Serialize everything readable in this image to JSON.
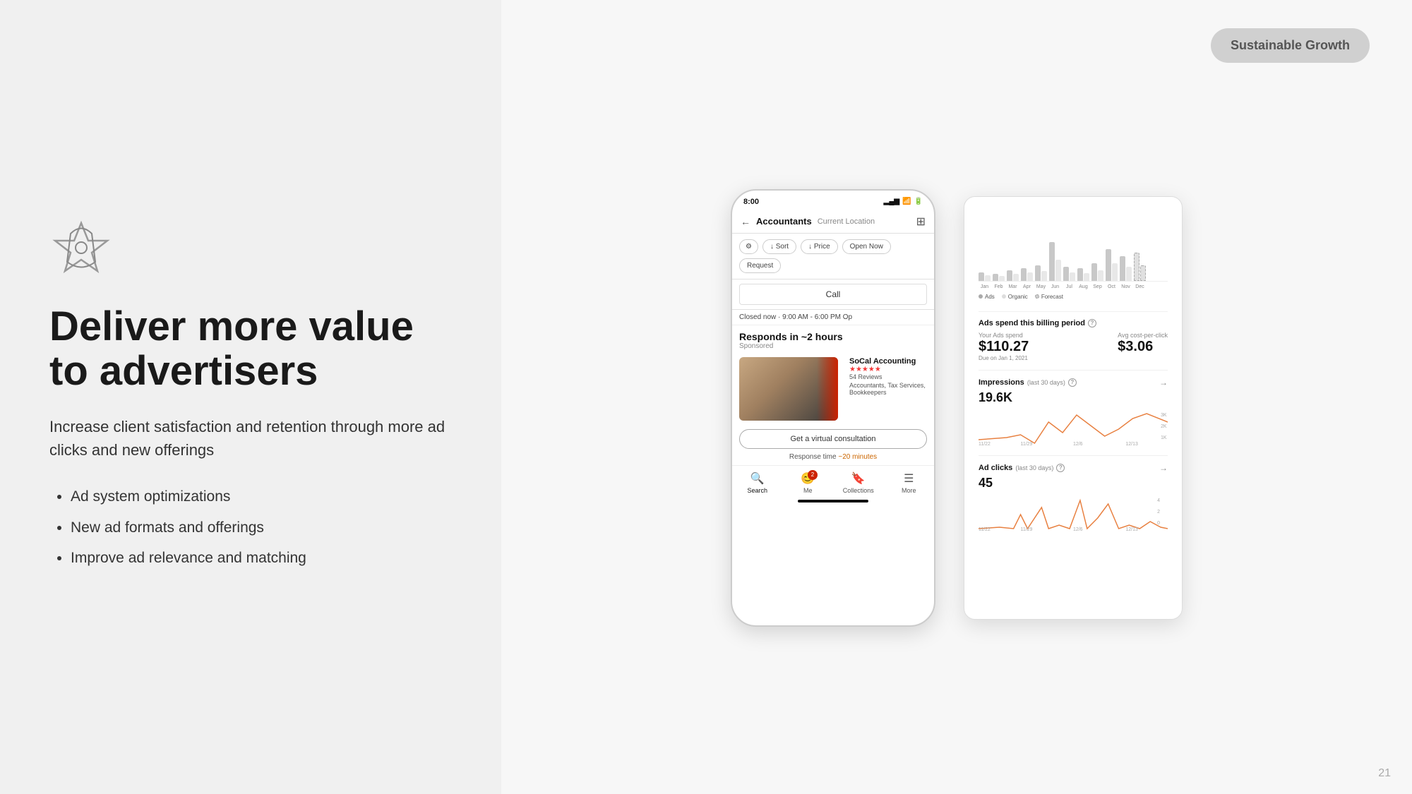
{
  "left": {
    "heading": "Deliver more value to advertisers",
    "subtext": "Increase client satisfaction and retention through more ad clicks and new offerings",
    "bullets": [
      "Ad system optimizations",
      "New ad formats and offerings",
      "Improve ad relevance and matching"
    ]
  },
  "badge": {
    "label": "Sustainable Growth"
  },
  "phone": {
    "status_time": "8:00",
    "nav_title": "Accountants",
    "nav_subtitle": "Current Location",
    "filters": [
      "⚙",
      "↓ Sort",
      "↓ Price",
      "Open Now",
      "Request"
    ],
    "call_label": "Call",
    "hours": "Closed now · 9:00 AM - 6:00 PM",
    "responds_title": "Responds in ~2 hours",
    "sponsored": "Sponsored",
    "business_name": "SoCal Accounting",
    "reviews": "54 Reviews",
    "category": "Accountants, Tax Services, Bookkeepers",
    "consult_btn": "Get a virtual consultation",
    "response_time": "Response time",
    "response_highlight": "~20 minutes",
    "nav_items": [
      "Search",
      "Me",
      "Collections",
      "More"
    ],
    "me_badge": "2"
  },
  "dashboard": {
    "ads_spend_title": "Ads spend this billing period",
    "ads_spend_value": "$110.27",
    "ads_spend_label": "Your Ads spend",
    "ads_spend_due": "Due on Jan 1, 2021",
    "avg_cpc_label": "Avg cost-per-click",
    "avg_cpc_value": "$3.06",
    "impressions_title": "Impressions",
    "impressions_period": "last 30 days",
    "impressions_value": "19.6K",
    "ad_clicks_title": "Ad clicks",
    "ad_clicks_period": "last 30 days",
    "ad_clicks_value": "45",
    "chart_months": [
      "Jan",
      "Feb",
      "Mar",
      "Apr",
      "May",
      "Jun",
      "Jul",
      "Aug",
      "Sep",
      "Oct",
      "Nov",
      "Dec"
    ],
    "legend_ads": "Ads",
    "legend_organic": "Organic",
    "legend_forecast": "Forecast",
    "x_labels_impressions": [
      "11/22",
      "11/29",
      "12/6",
      "12/13"
    ],
    "x_labels_clicks": [
      "11/22",
      "11/29",
      "12/6",
      "12/13"
    ]
  },
  "page_number": "21"
}
